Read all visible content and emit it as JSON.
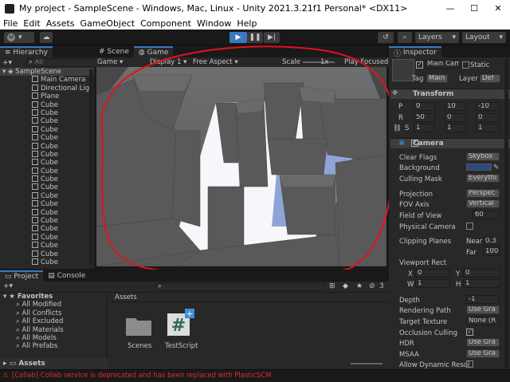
{
  "window": {
    "title": "My project - SampleScene - Windows, Mac, Linux - Unity 2021.3.21f1 Personal* <DX11>",
    "minimize": "—",
    "maximize": "☐",
    "close": "✕"
  },
  "menu": [
    "File",
    "Edit",
    "Assets",
    "GameObject",
    "Component",
    "Window",
    "Help"
  ],
  "toolbar": {
    "account": "M",
    "layers": "Layers",
    "layout": "Layout"
  },
  "hierarchy": {
    "tab": "Hierarchy",
    "search_placeholder": "All",
    "scene": "SampleScene",
    "items": [
      "Main Camera",
      "Directional Lig",
      "Plane",
      "Cube",
      "Cube",
      "Cube",
      "Cube",
      "Cube",
      "Cube",
      "Cube",
      "Cube",
      "Cube",
      "Cube",
      "Cube",
      "Cube",
      "Cube",
      "Cube",
      "Cube",
      "Cube",
      "Cube",
      "Cube",
      "Cube",
      "Cube"
    ]
  },
  "view_tabs": {
    "scene": "Scene",
    "game": "Game"
  },
  "game_bar": {
    "mode": "Game",
    "display": "Display 1",
    "aspect": "Free Aspect",
    "scale_label": "Scale",
    "scale_value": "1x",
    "play_focused": "Play Focused"
  },
  "project": {
    "tabs": [
      "Project",
      "Console"
    ],
    "favorites_label": "Favorites",
    "favorites": [
      "All Modified",
      "All Conflicts",
      "All Excluded",
      "All Materials",
      "All Models",
      "All Prefabs"
    ],
    "assets_root": "Assets",
    "breadcrumb": "Assets",
    "hidden_count": "3",
    "assets": [
      {
        "name": "Scenes",
        "type": "folder"
      },
      {
        "name": "TestScript",
        "type": "script"
      }
    ]
  },
  "inspector": {
    "tab": "Inspector",
    "object_name": "Main Cam",
    "static_label": "Static",
    "tag_label": "Tag",
    "tag_value": "Main",
    "layer_label": "Layer",
    "layer_value": "Def",
    "transform": {
      "title": "Transform",
      "position": {
        "label": "P",
        "x": "0",
        "y": "10",
        "z": "-10"
      },
      "rotation": {
        "label": "R",
        "x": "50",
        "y": "0",
        "z": "0"
      },
      "scale": {
        "label": "S",
        "x": "1",
        "y": "1",
        "z": "1"
      }
    },
    "camera": {
      "title": "Camera",
      "rows": [
        {
          "label": "Clear Flags",
          "value": "Skybox"
        },
        {
          "label": "Background",
          "value": ""
        },
        {
          "label": "Culling Mask",
          "value": "Everythi"
        },
        {
          "label": "Projection",
          "value": "Perspec"
        },
        {
          "label": "FOV Axis",
          "value": "Vertical"
        },
        {
          "label": "Field of View",
          "value": "60"
        },
        {
          "label": "Physical Camera",
          "value": ""
        },
        {
          "label": "Clipping Planes",
          "value": ""
        }
      ],
      "near_label": "Near",
      "near_value": "0.3",
      "far_label": "Far",
      "far_value": "100",
      "viewport_label": "Viewport Rect",
      "viewport": {
        "x": "0",
        "y": "0",
        "w": "1",
        "h": "1"
      },
      "depth_label": "Depth",
      "depth_value": "-1",
      "rendering_path_label": "Rendering Path",
      "rendering_path_value": "Use Gra",
      "target_texture_label": "Target Texture",
      "target_texture_value": "None (R",
      "occlusion_label": "Occlusion Culling",
      "hdr_label": "HDR",
      "hdr_value": "Use Gra",
      "msaa_label": "MSAA",
      "msaa_value": "Use Gra",
      "dynamic_label": "Allow Dynamic Resol"
    }
  },
  "status": "[Collab] Collab service is deprecated and has been replaced with PlasticSCM",
  "colors": {
    "accent": "#3a79bb",
    "annotation": "#e0141e",
    "error": "#d9302a"
  }
}
